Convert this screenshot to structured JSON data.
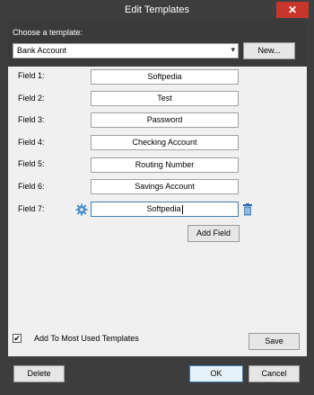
{
  "window": {
    "title": "Edit Templates",
    "close": "✕"
  },
  "template": {
    "choose_label": "Choose a template:",
    "selected": "Bank Account",
    "new_label": "New..."
  },
  "fields": [
    {
      "label": "Field 1:",
      "value": "Softpedia"
    },
    {
      "label": "Field 2:",
      "value": "Test"
    },
    {
      "label": "Field 3:",
      "value": "Password"
    },
    {
      "label": "Field 4:",
      "value": "Checking Account"
    },
    {
      "label": "Field 5:",
      "value": "Routing Number"
    },
    {
      "label": "Field 6:",
      "value": "Savings Account"
    },
    {
      "label": "Field 7:",
      "value": "Softpedia"
    }
  ],
  "add_field_label": "Add Field",
  "add_to_most_used": {
    "label": "Add To Most Used Templates",
    "checked": true,
    "mark": "✔"
  },
  "save_label": "Save",
  "footer": {
    "delete_label": "Delete",
    "ok_label": "OK",
    "cancel_label": "Cancel"
  },
  "colors": {
    "titlebar": "#3e3e3e",
    "close": "#c7362a",
    "panel": "#f0f0f0",
    "accent": "#3c7fb1"
  },
  "icons": {
    "settings": "gear-icon",
    "delete": "trash-icon",
    "dropdown": "chevron-down-icon"
  }
}
